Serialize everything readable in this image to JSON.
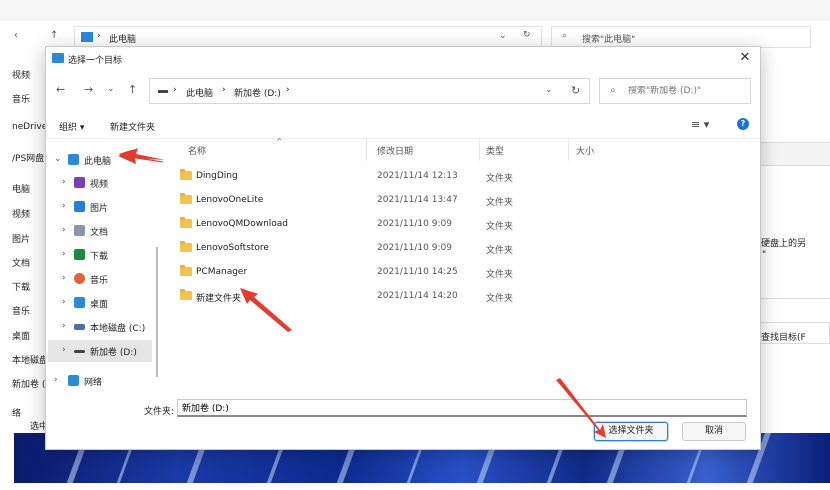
{
  "background": {
    "address_crumb": "此电脑",
    "search_placeholder": "搜索\"此电脑\"",
    "sidebar": [
      "视频",
      "音乐",
      "neDrive",
      "/PS网盘",
      "电脑",
      "视频",
      "图片",
      "文档",
      "下载",
      "音乐",
      "桌面",
      "本地磁盘",
      "新加卷 (",
      "络"
    ],
    "right_text_1": "硬盘上的另",
    "right_text_1b": "\"",
    "right_text_2": "查找目标(F",
    "status_text": "选中"
  },
  "dialog": {
    "title": "选择一个目标",
    "close_glyph": "✕",
    "nav": {
      "back": "←",
      "forward": "→",
      "recent": "⌄",
      "up": "↑"
    },
    "address": {
      "sep": "›",
      "crumbs": [
        "此电脑",
        "新加卷 (D:)"
      ],
      "dropdown": "⌄",
      "refresh": "↻"
    },
    "search": {
      "icon": "⌕",
      "placeholder": "搜索\"新加卷 (D:)\""
    },
    "commands": {
      "organize": "组织 ▾",
      "new_folder": "新建文件夹",
      "view": "≡ ▾",
      "help": "?"
    },
    "tree": [
      {
        "label": "此电脑",
        "icon": "computer-icon",
        "color": "#2a8ad8",
        "chev": "⌄"
      },
      {
        "label": "视频",
        "icon": "video-icon",
        "color": "#7b3fb5",
        "chev": "›"
      },
      {
        "label": "图片",
        "icon": "picture-icon",
        "color": "#2a7bd5",
        "chev": "›"
      },
      {
        "label": "文档",
        "icon": "document-icon",
        "color": "#8a96a8",
        "chev": "›"
      },
      {
        "label": "下载",
        "icon": "download-icon",
        "color": "#1c8a3e",
        "chev": "›"
      },
      {
        "label": "音乐",
        "icon": "music-icon",
        "color": "#e0633a",
        "chev": "›"
      },
      {
        "label": "桌面",
        "icon": "desktop-icon",
        "color": "#2a8ad8",
        "chev": "›"
      },
      {
        "label": "本地磁盘 (C:)",
        "icon": "local-disk-icon",
        "color": "#4a6fa5",
        "chev": "›"
      },
      {
        "label": "新加卷 (D:)",
        "icon": "drive-icon",
        "color": "#444444",
        "chev": "›"
      },
      {
        "label": "网络",
        "icon": "network-icon",
        "color": "#2a8ad8",
        "chev": "›"
      }
    ],
    "columns": {
      "name": "名称",
      "modified": "修改日期",
      "type": "类型",
      "size": "大小",
      "sort_indicator": "^"
    },
    "files": [
      {
        "name": "DingDing",
        "modified": "2021/11/14 12:13",
        "type": "文件夹"
      },
      {
        "name": "LenovoOneLite",
        "modified": "2021/11/14 13:47",
        "type": "文件夹"
      },
      {
        "name": "LenovoQMDownload",
        "modified": "2021/11/10 9:09",
        "type": "文件夹"
      },
      {
        "name": "LenovoSoftstore",
        "modified": "2021/11/10 9:09",
        "type": "文件夹"
      },
      {
        "name": "PCManager",
        "modified": "2021/11/10 14:25",
        "type": "文件夹"
      },
      {
        "name": "新建文件夹",
        "modified": "2021/11/14 14:20",
        "type": "文件夹"
      }
    ],
    "folder_label": "文件夹:",
    "folder_value": "新加卷 (D:)",
    "select_button": "选择文件夹",
    "cancel_button": "取消"
  },
  "colors": {
    "accent": "#1e72d0",
    "arrow": "#e53a2e",
    "folder": "#f3c24a"
  }
}
